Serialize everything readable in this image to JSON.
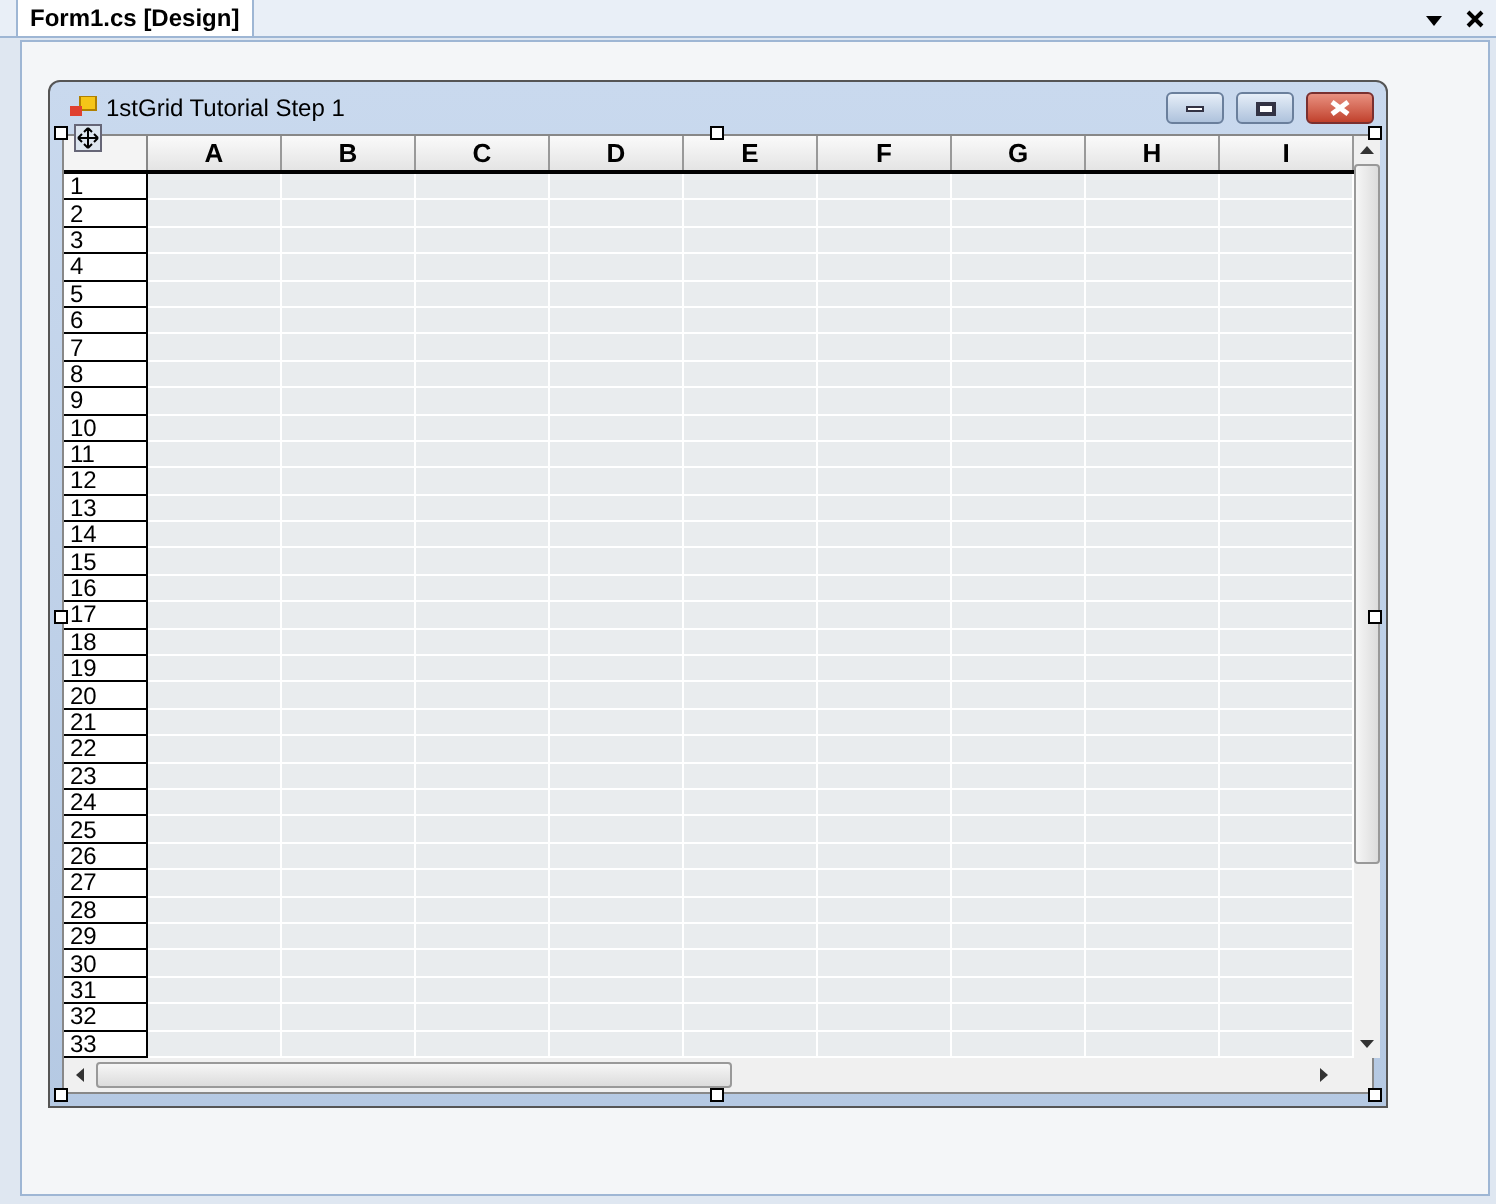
{
  "tab": {
    "label": "Form1.cs [Design]",
    "selected": true
  },
  "form": {
    "title": "1stGrid Tutorial Step 1"
  },
  "grid": {
    "columns": [
      "A",
      "B",
      "C",
      "D",
      "E",
      "F",
      "G",
      "H",
      "I"
    ],
    "rows": [
      "1",
      "2",
      "3",
      "4",
      "5",
      "6",
      "7",
      "8",
      "9",
      "10",
      "11",
      "12",
      "13",
      "14",
      "15",
      "16",
      "17",
      "18",
      "19",
      "20",
      "21",
      "22",
      "23",
      "24",
      "25",
      "26",
      "27",
      "28",
      "29",
      "30",
      "31",
      "32",
      "33"
    ]
  }
}
